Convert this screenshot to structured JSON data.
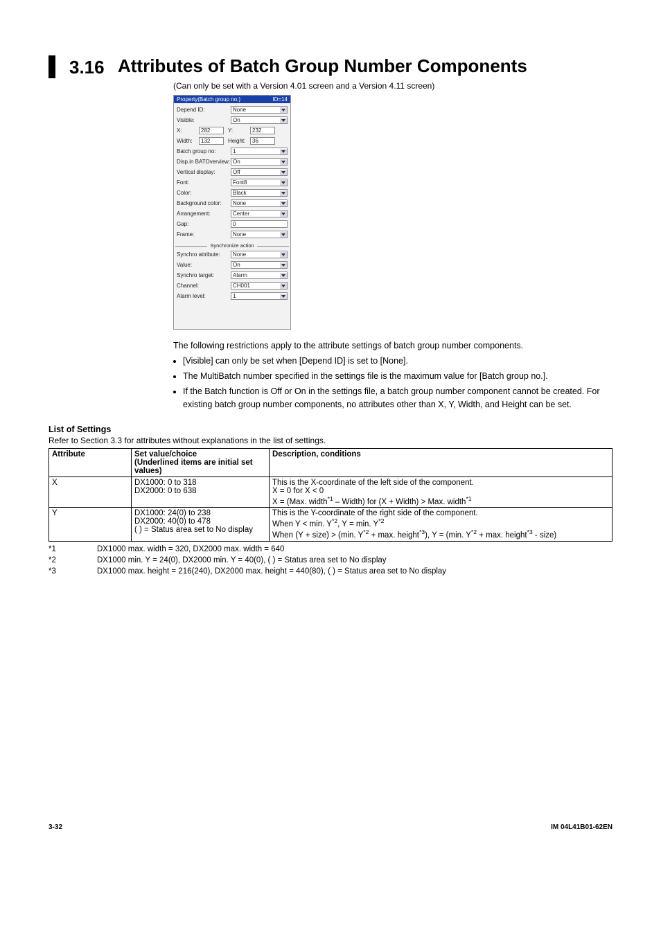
{
  "chapter": {
    "num": "3.16",
    "title": "Attributes of Batch Group Number Components"
  },
  "version_note": "(Can only be set with a Version 4.01 screen and a Version 4.11 screen)",
  "panel": {
    "header_left": "Property(Batch group no.)",
    "header_right": "ID=14",
    "rows": {
      "depend_id": {
        "label": "Depend ID:",
        "value": "None"
      },
      "visible": {
        "label": "Visible:",
        "value": "On"
      },
      "x": {
        "label": "X:",
        "value": "282"
      },
      "y": {
        "label": "Y:",
        "value": "232"
      },
      "width": {
        "label": "Width:",
        "value": "132"
      },
      "height": {
        "label": "Height:",
        "value": "36"
      },
      "batch_group_no": {
        "label": "Batch group no:",
        "value": "1"
      },
      "disp_bat": {
        "label": "Disp.in BATOverview:",
        "value": "On"
      },
      "vdisp": {
        "label": "Vertical display:",
        "value": "Off"
      },
      "font": {
        "label": "Font:",
        "value": "Font8"
      },
      "color": {
        "label": "Color:",
        "value": "Black"
      },
      "bgcolor": {
        "label": "Background color:",
        "value": "None"
      },
      "arrangement": {
        "label": "Arrangement:",
        "value": "Center"
      },
      "gap": {
        "label": "Gap:",
        "value": "0"
      },
      "frame": {
        "label": "Frame:",
        "value": "None"
      }
    },
    "sync_title": "Synchronize action",
    "sync": {
      "attr": {
        "label": "Synchro attribute:",
        "value": "None"
      },
      "value": {
        "label": "Value:",
        "value": "On"
      },
      "target": {
        "label": "Synchro target:",
        "value": "Alarm"
      },
      "channel": {
        "label": "Channel:",
        "value": "CH001"
      },
      "alarm": {
        "label": "Alarm level:",
        "value": "1"
      }
    }
  },
  "intro": "The following restrictions apply to the attribute settings of batch group number components.",
  "bullets": [
    "[Visible] can only be set when [Depend ID] is set to [None].",
    "The MultiBatch number specified in the settings file is the maximum value for [Batch group no.].",
    "If the Batch function is Off or On in the settings file, a batch group number component cannot be created. For existing batch group number components, no attributes other than X, Y, Width, and Height can be set."
  ],
  "list_heading": "List of Settings",
  "refer": "Refer to Section 3.3 for attributes without explanations in the list of settings.",
  "table_headers": {
    "attr": "Attribute",
    "set": "Set value/choice\n(Underlined items are initial set values)",
    "desc": "Description, conditions"
  },
  "table_rows": [
    {
      "attr": "X",
      "set": "DX1000: 0 to 318\nDX2000: 0 to 638",
      "desc_html": "This is the X-coordinate of the left side of the component.<br>X = 0 for X &lt; 0<br>X = (Max. width<sup>*1</sup> – Width) for (X + Width) &gt; Max. width<sup>*1</sup>"
    },
    {
      "attr": "Y",
      "set": "DX1000: 24(0) to 238\nDX2000: 40(0) to 478\n(   ) = Status area set to No display",
      "desc_html": "This is the Y-coordinate of the right side of the component.<br>When Y &lt; min. Y<sup>*2</sup>, Y = min. Y<sup>*2</sup><br>When (Y + size) &gt; (min. Y<sup>*2</sup> + max. height<sup>*3</sup>), Y = (min. Y<sup>*2</sup> + max. height<sup>*3</sup> - size)"
    }
  ],
  "footnotes": [
    {
      "id": "*1",
      "text": "DX1000 max. width = 320, DX2000 max. width = 640"
    },
    {
      "id": "*2",
      "text": "DX1000 min. Y = 24(0), DX2000 min. Y = 40(0), (   ) = Status area set to No display"
    },
    {
      "id": "*3",
      "text": "DX1000 max. height = 216(240), DX2000 max. height = 440(80), (   ) = Status area set to No display"
    }
  ],
  "footer": {
    "left": "3-32",
    "right": "IM 04L41B01-62EN"
  }
}
